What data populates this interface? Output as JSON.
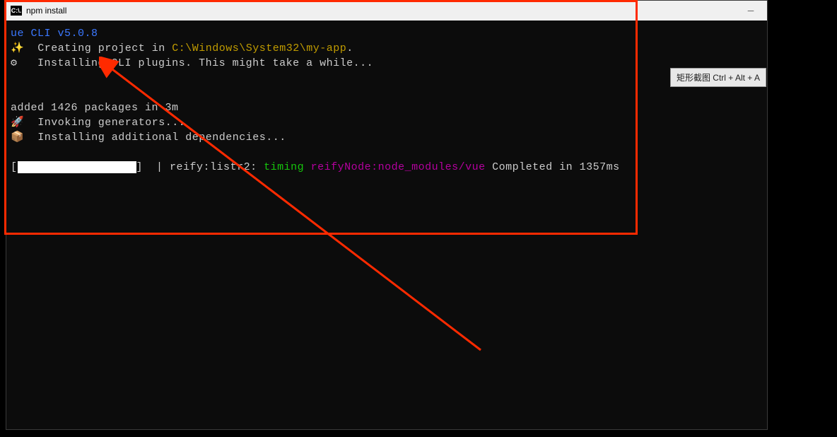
{
  "titlebar": {
    "icon_text": "C:\\.",
    "title": "npm install"
  },
  "terminal": {
    "vue_cli_prefix": "ue CLI ",
    "vue_cli_version": "v5.0.8",
    "line2_marker": "✨",
    "line2_text": "  Creating project in ",
    "line2_path": "C:\\Windows\\System32\\my-app",
    "line2_dot": ".",
    "line3_marker": "⚙",
    "line3_text": "   Installing CLI plugins. This might take a while...",
    "line5_text": "added 1426 packages in 3m",
    "line6_marker": "🚀",
    "line6_text": "  Invoking generators...",
    "line7_marker": "📦",
    "line7_text": "  Installing additional dependencies...",
    "reify_bracket": "]",
    "reify_prefix": "| reify:listr2: ",
    "reify_timing": "timing",
    "reify_node": " reifyNode:node_modules/vue",
    "reify_completed": " Completed in 1357ms"
  },
  "tooltip": {
    "text": "矩形截图 Ctrl + Alt + A"
  }
}
